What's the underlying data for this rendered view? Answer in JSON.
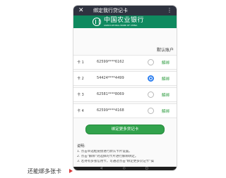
{
  "appbar": {
    "close_icon": "close-icon",
    "title": "绑定我行贷记卡",
    "menu_icon": "more-vertical-icon"
  },
  "bank": {
    "name_cn": "中国农业银行",
    "name_en": "AGRICULTURAL BANK OF CHINA",
    "logo_icon": "bank-logo-icon",
    "brand_color": "#0f8a5f"
  },
  "list": {
    "header": "默认账户"
  },
  "cards": [
    {
      "label": "卡 1",
      "number": "62599****6162",
      "selected": false,
      "action": "解绑"
    },
    {
      "label": "卡 2",
      "number": "54424****4499",
      "selected": true,
      "action": "解绑"
    },
    {
      "label": "卡 3",
      "number": "62581****8069",
      "selected": false,
      "action": "解绑"
    },
    {
      "label": "卡 4",
      "number": "62599****4168",
      "selected": false,
      "action": "解绑"
    }
  ],
  "bind_more_button": "绑定更多贷记卡",
  "notes": {
    "title": "说明:",
    "items": [
      "1. 点击单选框链接进行默认卡片设置。",
      "2. 点击\"解绑\"对选择的卡片进行解绑绑定。",
      "3. 若持有多张信用卡，可通过点击\"绑定更多贷记卡\"操"
    ]
  },
  "navbar": {
    "back_icon": "back-icon",
    "home_icon": "home-icon",
    "recent_icon": "recent-apps-icon"
  },
  "caption": "还能绑多张卡",
  "colors": {
    "accent": "#31a24c",
    "selected": "#2d7ff0",
    "arrow": "#d7393a"
  }
}
